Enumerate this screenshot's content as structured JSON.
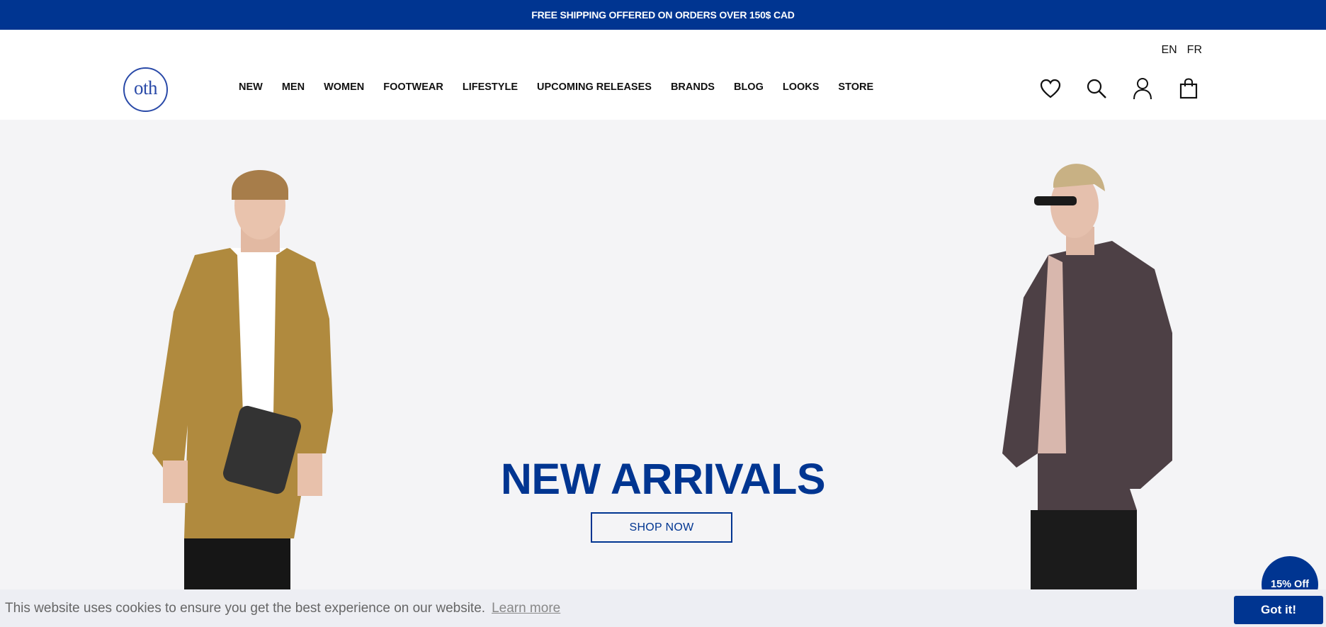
{
  "announcement": "FREE SHIPPING OFFERED ON ORDERS OVER 150$ CAD",
  "header": {
    "languages": [
      "EN",
      "FR"
    ],
    "logo_text": "oth",
    "nav": [
      "NEW",
      "MEN",
      "WOMEN",
      "FOOTWEAR",
      "LIFESTYLE",
      "UPCOMING RELEASES",
      "BRANDS",
      "BLOG",
      "LOOKS",
      "STORE"
    ],
    "icons": [
      "heart-icon",
      "search-icon",
      "account-icon",
      "bag-icon"
    ]
  },
  "hero": {
    "headline": "NEW ARRIVALS",
    "cta": "SHOP NOW"
  },
  "promo": {
    "label": "15% Off"
  },
  "cookie": {
    "message": "This website uses cookies to ensure you get the best experience on our website.",
    "learn_more": "Learn more",
    "accept": "Got it!"
  },
  "colors": {
    "brand": "#003591",
    "background": "#f4f4f6"
  }
}
